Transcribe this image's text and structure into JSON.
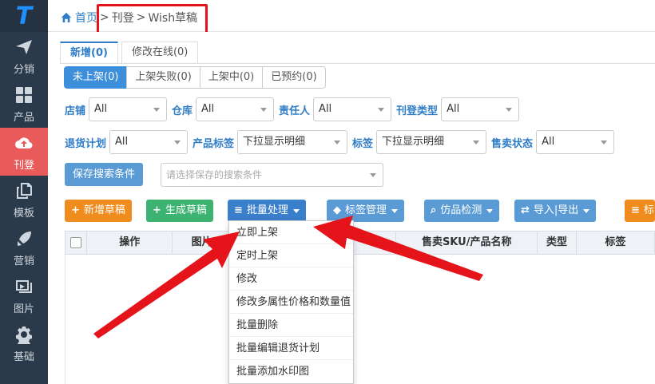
{
  "sidebar": {
    "logo": "T",
    "items": [
      {
        "label": "分销",
        "icon": "paper-plane-icon"
      },
      {
        "label": "产品",
        "icon": "grid-icon"
      },
      {
        "label": "刊登",
        "icon": "cloud-upload-icon",
        "active": true
      },
      {
        "label": "模板",
        "icon": "copy-icon"
      },
      {
        "label": "营销",
        "icon": "rocket-icon"
      },
      {
        "label": "图片",
        "icon": "image-icon"
      },
      {
        "label": "基础",
        "icon": "gear-icon"
      }
    ]
  },
  "breadcrumb": {
    "home": "首页",
    "sep": ">",
    "level1": "刊登",
    "level2": "Wish草稿"
  },
  "tabs": [
    {
      "label": "新增(0)",
      "active": true
    },
    {
      "label": "修改在线(0)"
    }
  ],
  "subtabs": [
    {
      "label": "未上架(0)",
      "active": true
    },
    {
      "label": "上架失败(0)"
    },
    {
      "label": "上架中(0)"
    },
    {
      "label": "已预约(0)"
    }
  ],
  "filters": {
    "row1": {
      "shop_label": "店铺",
      "shop_value": "All",
      "warehouse_label": "仓库",
      "warehouse_value": "All",
      "owner_label": "责任人",
      "owner_value": "All",
      "listing_type_label": "刊登类型",
      "listing_type_value": "All"
    },
    "row2": {
      "return_label": "退货计划",
      "return_value": "All",
      "product_tag_label": "产品标签",
      "product_tag_value": "下拉显示明细",
      "tag_label": "标签",
      "tag_value": "下拉显示明细",
      "sale_status_label": "售卖状态",
      "sale_status_value": "All"
    },
    "save_button": "保存搜索条件",
    "saved_placeholder": "请选择保存的搜索条件"
  },
  "actions": {
    "new_draft": "新增草稿",
    "generate_draft": "生成草稿",
    "batch": "批量处理",
    "tag_manage": "标签管理",
    "imitation_check": "仿品检测",
    "import_export": "导入|导出",
    "more": "标"
  },
  "table": {
    "headers": [
      "操作",
      "图片",
      "售卖SKU/产品名称",
      "类型",
      "标签"
    ]
  },
  "batch_menu": [
    "立即上架",
    "定时上架",
    "修改",
    "修改多属性价格和数量值",
    "批量删除",
    "批量编辑退货计划",
    "批量添加水印图"
  ],
  "colors": {
    "sidebar": "#2b3a4a",
    "active_nav": "#e95a5a",
    "primary": "#3a7fcc",
    "orange": "#f08c1e",
    "green": "#3cb371",
    "annotation_red": "#e5141b"
  }
}
